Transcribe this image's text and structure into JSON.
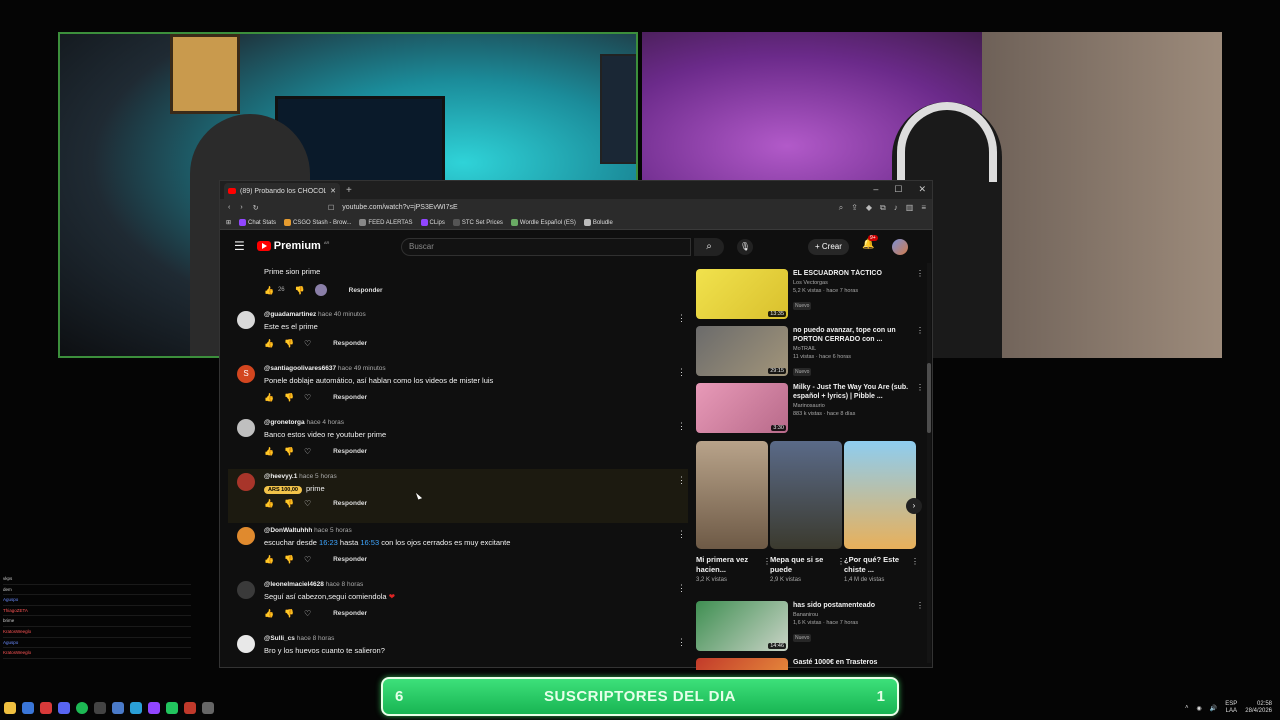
{
  "browser": {
    "tab_title": "(89) Probando los CHOCOLATE",
    "url": "youtube.com/watch?v=jPS3EvWI7sE",
    "new_tab": "+",
    "window_controls": [
      "–",
      "☐",
      "✕"
    ],
    "bookmarks": [
      "Chat Stats",
      "CSGO Stash - Brow...",
      "FEED ALERTAS",
      "CLips",
      "STC Set Prices",
      "Wordle Español (ES)",
      "Boludle"
    ]
  },
  "youtube": {
    "logo": "Premium",
    "logo_region": "AR",
    "search_placeholder": "Buscar",
    "create_label": "Crear",
    "notif_count": "9+"
  },
  "top_comment": {
    "text": "Prime sion prime",
    "likes": "26",
    "reply_label": "Responder"
  },
  "comments": [
    {
      "user": "@guadamartinez",
      "time": "hace 40 minutos",
      "text": "Este es el prime",
      "reply": "Responder"
    },
    {
      "user": "@santiagoolivares6637",
      "time": "hace 49 minutos",
      "text": "Ponele doblaje automático, así hablan como los videos de mister luis",
      "reply": "Responder",
      "initial": "S"
    },
    {
      "user": "@gronetorga",
      "time": "hace 4 horas",
      "text": "Banco estos video re youtuber prime",
      "reply": "Responder"
    },
    {
      "user": "@heevyy.1",
      "time": "hace 5 horas",
      "text": "prime",
      "tip": "ARS 100,00",
      "reply": "Responder"
    },
    {
      "user": "@DonWaltuhhh",
      "time": "hace 5 horas",
      "text_a": "escuchar desde ",
      "ts1": "16:23",
      "text_b": " hasta ",
      "ts2": "16:53",
      "text_c": " con los ojos cerrados es muy excitante",
      "reply": "Responder"
    },
    {
      "user": "@leonelmaciel4628",
      "time": "hace 8 horas",
      "text": "Seguí así cabezon,segui comiendola",
      "heart": "❤",
      "reply": "Responder"
    },
    {
      "user": "@Sulli_cs",
      "time": "hace 8 horas",
      "text": "Bro y los huevos cuanto te salieron?",
      "reply": "Responder"
    }
  ],
  "sidebar": {
    "videos_top": [
      {
        "title": "EL ESCUADRON TÁCTICO",
        "channel": "Los Vectorgas",
        "stats": "5,2 K vistas · hace 7 horas",
        "badge": "Nuevo",
        "duration": "13:35"
      },
      {
        "title": "no puedo avanzar, tope con un PORTON CERRADO con ...",
        "channel": "MoTRAIL",
        "stats": "11 vistas · hace 6 horas",
        "badge": "Nuevo",
        "duration": "29:15"
      },
      {
        "title": "Milky - Just The Way You Are (sub. español + lyrics) | Pibble ...",
        "channel": "Marinosaurio",
        "stats": "883 k vistas · hace 8 días",
        "duration": "3:30"
      }
    ],
    "shorts": [
      {
        "title": "Mi primera vez hacien...",
        "views": "3,2 K vistas"
      },
      {
        "title": "Mepa que si se puede",
        "views": "2,9 K vistas"
      },
      {
        "title": "¿Por qué? Este chiste ...",
        "views": "1,4 M de vistas"
      }
    ],
    "videos_bottom": [
      {
        "title": "has sido postamenteado",
        "channel": "Bananirou",
        "stats": "1,6 K vistas · hace 7 horas",
        "badge": "Nuevo",
        "duration": "14:46"
      },
      {
        "title": "Gasté 1000€ en Trasteros"
      }
    ]
  },
  "chat": [
    {
      "nick": "",
      "text": "vkps"
    },
    {
      "nick": "",
      "text": "dem"
    },
    {
      "nick": "Aguspo",
      "text": ""
    },
    {
      "nick": "ThiagoZETA",
      "text": ""
    },
    {
      "nick": "",
      "text": "brime"
    },
    {
      "nick": "KratosWeeglo",
      "text": ""
    },
    {
      "nick": "Aguspo",
      "text": ""
    },
    {
      "nick": "KratosWeeglo",
      "text": ""
    }
  ],
  "banner": {
    "label": "SUSCRIPTORES DEL DIA",
    "left_num": "6",
    "right_num": "1"
  },
  "taskbar": {
    "lang1": "ESP",
    "lang2": "LAA",
    "time": "02:58",
    "date": "28/4/2026"
  },
  "colors": {
    "yt_red": "#ff0000",
    "link_blue": "#3ea6ff",
    "banner_green": "#2fcf66",
    "tip_gold": "#f2c34a"
  }
}
